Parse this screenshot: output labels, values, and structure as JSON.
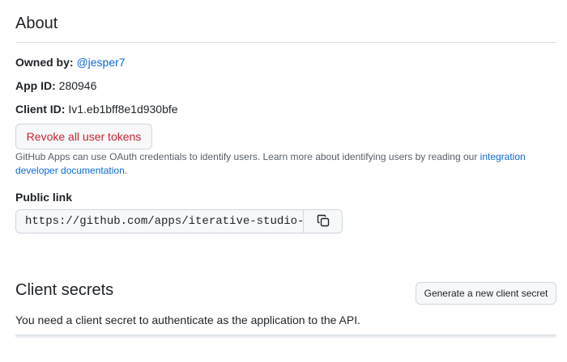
{
  "about": {
    "heading": "About",
    "owned_by_label": "Owned by:",
    "owned_by_value": "@jesper7",
    "app_id_label": "App ID:",
    "app_id_value": "280946",
    "client_id_label": "Client ID:",
    "client_id_value": "Iv1.eb1bff8e1d930bfe",
    "revoke_button": "Revoke all user tokens",
    "help_text": "GitHub Apps can use OAuth credentials to identify users. Learn more about identifying users by reading our ",
    "help_link": "integration developer documentation",
    "help_suffix": "."
  },
  "public_link": {
    "label": "Public link",
    "url": "https://github.com/apps/iterative-studio-te",
    "copy_icon": "copy-icon"
  },
  "client_secrets": {
    "heading": "Client secrets",
    "generate_button": "Generate a new client secret",
    "description": "You need a client secret to authenticate as the application to the API."
  },
  "colors": {
    "link": "#0969da",
    "danger": "#cf222e",
    "border": "#d0d7de",
    "muted": "#57606a"
  }
}
